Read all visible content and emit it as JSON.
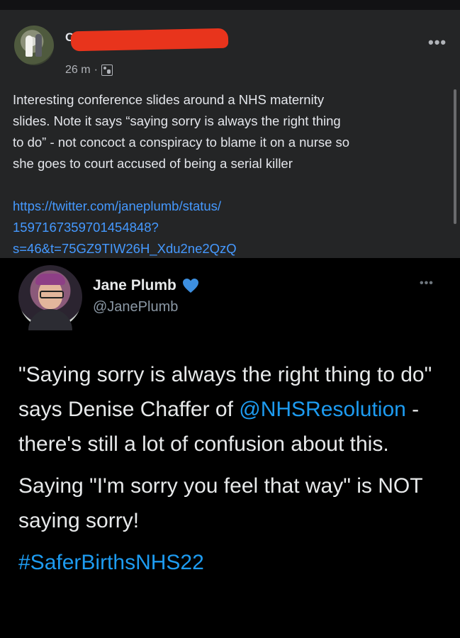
{
  "facebook_post": {
    "author_initial": "C",
    "time": "26 m",
    "separator": "·",
    "privacy_icon": "friends-icon",
    "more_icon": "•••",
    "text": "Interesting conference slides around a NHS maternity\nslides. Note it says “saying sorry is always the right thing\nto do” - not concoct a conspiracy to blame it on a nurse so\nshe goes to court accused of being a serial killer",
    "link": "https://twitter.com/janeplumb/status/\n1597167359701454848?\ns=46&t=75GZ9TIW26H_Xdu2ne2QzQ",
    "redaction_color": "#e8341c"
  },
  "tweet": {
    "name": "Jane Plumb",
    "handle": "@JanePlumb",
    "more_icon": "•••",
    "badge_icon": "blue-heart-icon",
    "p1_a": "\"Saying sorry is always the right thing to do\" says Denise Chaffer of ",
    "p1_mention": "@NHSResolution",
    "p1_b": " - there's still a lot of confusion about this.",
    "p2": "Saying \"I'm sorry you feel that way\" is NOT saying sorry!",
    "hashtag": "#SaferBirthsNHS22",
    "link_color": "#1d9bf0"
  }
}
